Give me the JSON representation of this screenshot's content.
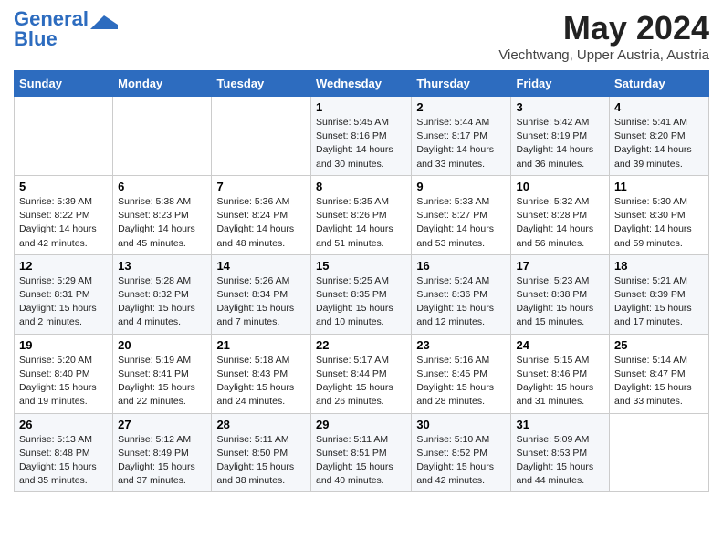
{
  "logo": {
    "line1": "General",
    "line2": "Blue"
  },
  "title": "May 2024",
  "subtitle": "Viechtwang, Upper Austria, Austria",
  "headers": [
    "Sunday",
    "Monday",
    "Tuesday",
    "Wednesday",
    "Thursday",
    "Friday",
    "Saturday"
  ],
  "weeks": [
    [
      {
        "day": "",
        "info": ""
      },
      {
        "day": "",
        "info": ""
      },
      {
        "day": "",
        "info": ""
      },
      {
        "day": "1",
        "info": "Sunrise: 5:45 AM\nSunset: 8:16 PM\nDaylight: 14 hours and 30 minutes."
      },
      {
        "day": "2",
        "info": "Sunrise: 5:44 AM\nSunset: 8:17 PM\nDaylight: 14 hours and 33 minutes."
      },
      {
        "day": "3",
        "info": "Sunrise: 5:42 AM\nSunset: 8:19 PM\nDaylight: 14 hours and 36 minutes."
      },
      {
        "day": "4",
        "info": "Sunrise: 5:41 AM\nSunset: 8:20 PM\nDaylight: 14 hours and 39 minutes."
      }
    ],
    [
      {
        "day": "5",
        "info": "Sunrise: 5:39 AM\nSunset: 8:22 PM\nDaylight: 14 hours and 42 minutes."
      },
      {
        "day": "6",
        "info": "Sunrise: 5:38 AM\nSunset: 8:23 PM\nDaylight: 14 hours and 45 minutes."
      },
      {
        "day": "7",
        "info": "Sunrise: 5:36 AM\nSunset: 8:24 PM\nDaylight: 14 hours and 48 minutes."
      },
      {
        "day": "8",
        "info": "Sunrise: 5:35 AM\nSunset: 8:26 PM\nDaylight: 14 hours and 51 minutes."
      },
      {
        "day": "9",
        "info": "Sunrise: 5:33 AM\nSunset: 8:27 PM\nDaylight: 14 hours and 53 minutes."
      },
      {
        "day": "10",
        "info": "Sunrise: 5:32 AM\nSunset: 8:28 PM\nDaylight: 14 hours and 56 minutes."
      },
      {
        "day": "11",
        "info": "Sunrise: 5:30 AM\nSunset: 8:30 PM\nDaylight: 14 hours and 59 minutes."
      }
    ],
    [
      {
        "day": "12",
        "info": "Sunrise: 5:29 AM\nSunset: 8:31 PM\nDaylight: 15 hours and 2 minutes."
      },
      {
        "day": "13",
        "info": "Sunrise: 5:28 AM\nSunset: 8:32 PM\nDaylight: 15 hours and 4 minutes."
      },
      {
        "day": "14",
        "info": "Sunrise: 5:26 AM\nSunset: 8:34 PM\nDaylight: 15 hours and 7 minutes."
      },
      {
        "day": "15",
        "info": "Sunrise: 5:25 AM\nSunset: 8:35 PM\nDaylight: 15 hours and 10 minutes."
      },
      {
        "day": "16",
        "info": "Sunrise: 5:24 AM\nSunset: 8:36 PM\nDaylight: 15 hours and 12 minutes."
      },
      {
        "day": "17",
        "info": "Sunrise: 5:23 AM\nSunset: 8:38 PM\nDaylight: 15 hours and 15 minutes."
      },
      {
        "day": "18",
        "info": "Sunrise: 5:21 AM\nSunset: 8:39 PM\nDaylight: 15 hours and 17 minutes."
      }
    ],
    [
      {
        "day": "19",
        "info": "Sunrise: 5:20 AM\nSunset: 8:40 PM\nDaylight: 15 hours and 19 minutes."
      },
      {
        "day": "20",
        "info": "Sunrise: 5:19 AM\nSunset: 8:41 PM\nDaylight: 15 hours and 22 minutes."
      },
      {
        "day": "21",
        "info": "Sunrise: 5:18 AM\nSunset: 8:43 PM\nDaylight: 15 hours and 24 minutes."
      },
      {
        "day": "22",
        "info": "Sunrise: 5:17 AM\nSunset: 8:44 PM\nDaylight: 15 hours and 26 minutes."
      },
      {
        "day": "23",
        "info": "Sunrise: 5:16 AM\nSunset: 8:45 PM\nDaylight: 15 hours and 28 minutes."
      },
      {
        "day": "24",
        "info": "Sunrise: 5:15 AM\nSunset: 8:46 PM\nDaylight: 15 hours and 31 minutes."
      },
      {
        "day": "25",
        "info": "Sunrise: 5:14 AM\nSunset: 8:47 PM\nDaylight: 15 hours and 33 minutes."
      }
    ],
    [
      {
        "day": "26",
        "info": "Sunrise: 5:13 AM\nSunset: 8:48 PM\nDaylight: 15 hours and 35 minutes."
      },
      {
        "day": "27",
        "info": "Sunrise: 5:12 AM\nSunset: 8:49 PM\nDaylight: 15 hours and 37 minutes."
      },
      {
        "day": "28",
        "info": "Sunrise: 5:11 AM\nSunset: 8:50 PM\nDaylight: 15 hours and 38 minutes."
      },
      {
        "day": "29",
        "info": "Sunrise: 5:11 AM\nSunset: 8:51 PM\nDaylight: 15 hours and 40 minutes."
      },
      {
        "day": "30",
        "info": "Sunrise: 5:10 AM\nSunset: 8:52 PM\nDaylight: 15 hours and 42 minutes."
      },
      {
        "day": "31",
        "info": "Sunrise: 5:09 AM\nSunset: 8:53 PM\nDaylight: 15 hours and 44 minutes."
      },
      {
        "day": "",
        "info": ""
      }
    ]
  ]
}
